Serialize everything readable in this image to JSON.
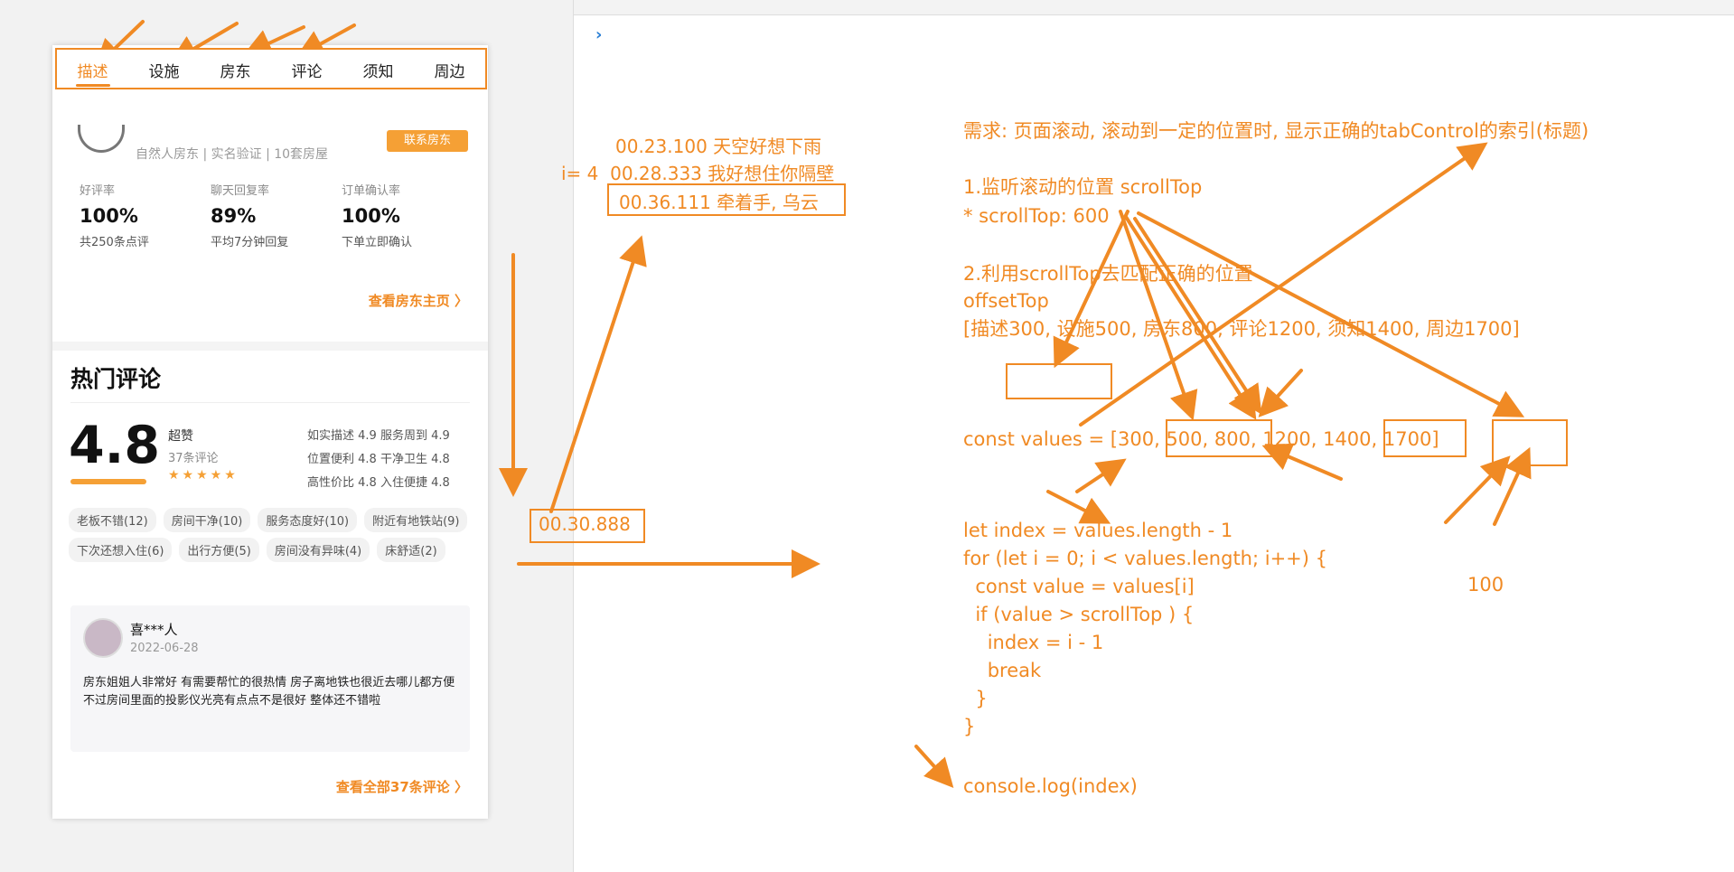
{
  "phone": {
    "tabs": [
      "描述",
      "设施",
      "房东",
      "评论",
      "须知",
      "周边"
    ],
    "host": {
      "meta": "自然人房东 | 实名验证 | 10套房屋",
      "contact_button": "联系房东",
      "stats": [
        {
          "label": "好评率",
          "value": "100%",
          "sub": "共250条点评"
        },
        {
          "label": "聊天回复率",
          "value": "89%",
          "sub": "平均7分钟回复"
        },
        {
          "label": "订单确认率",
          "value": "100%",
          "sub": "下单立即确认"
        }
      ],
      "link": "查看房东主页 〉"
    },
    "comments": {
      "title": "热门评论",
      "score": "4.8",
      "score_word": "超赞",
      "score_count": "37条评论",
      "stars": "★★★★★",
      "sub_scores": [
        "如实描述 4.9  服务周到 4.9",
        "位置便利 4.8  干净卫生 4.8",
        "高性价比 4.8  入住便捷 4.8"
      ],
      "tags": [
        "老板不错(12)",
        "房间干净(10)",
        "服务态度好(10)",
        "附近有地铁站(9)",
        "下次还想入住(6)",
        "出行方便(5)",
        "房间没有异味(4)",
        "床舒适(2)"
      ],
      "review": {
        "name": "喜***人",
        "date": "2022-06-28",
        "text": "房东姐姐人非常好 有需要帮忙的很热情 房子离地铁也很近去哪儿都方便 不过房间里面的投影仪光亮有点点不是很好 整体还不错啦"
      },
      "all_link": "查看全部37条评论 〉"
    }
  },
  "console": {
    "prompt": "›"
  },
  "annotations": {
    "lyrics": [
      "00.23.100 天空好想下雨",
      "i= 4  00.28.333 我好想住你隔壁",
      "00.36.111 牵着手, 乌云"
    ],
    "current_time": "00.30.888",
    "requirement": "需求: 页面滚动, 滚动到一定的位置时, 显示正确的tabControl的索引(标题)",
    "step1": "1.监听滚动的位置 scrollTop",
    "step1_value": "* scrollTop: 600",
    "step2": "2.利用scrollTop去匹配正确的位置",
    "step2_prop": "offsetTop",
    "step2_list": "[描述300, 设施500, 房东800, 评论1200, 须知1400, 周边1700]",
    "values_line": "const values = [300, 500, 800, 1200, 1400, 1700]",
    "code_lines": [
      "let index = values.length - 1",
      "for (let i = 0; i < values.length; i++) {",
      "  const value = values[i]",
      "  if (value > scrollTop ) {",
      "    index = i - 1",
      "    break",
      "  }",
      "}"
    ],
    "log_line": "console.log(index)",
    "side_number": "100"
  },
  "colors": {
    "accent": "#f08a24",
    "prompt": "#2a7fd4"
  }
}
